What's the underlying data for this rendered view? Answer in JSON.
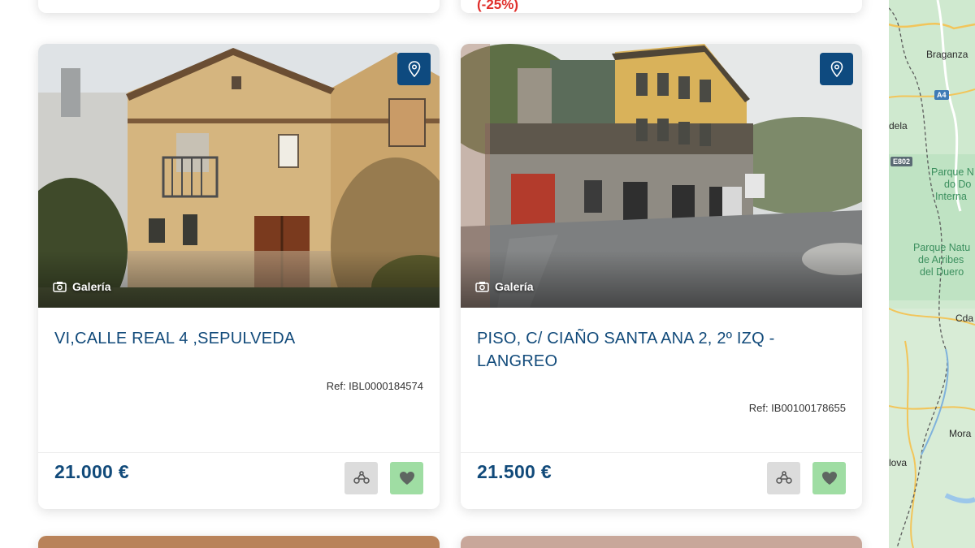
{
  "listings": [
    {
      "title": "VI,CALLE REAL 4 ,SEPULVEDA",
      "ref": "Ref: IBL0000184574",
      "price": "21.000 €",
      "gallery_label": "Galería",
      "pin_icon": "map-pin-icon",
      "compare_icon": "compare-icon",
      "favorite_icon": "heart-icon"
    },
    {
      "title": "PISO, C/ CIAÑO SANTA ANA 2, 2º IZQ - LANGREO",
      "ref": "Ref: IB00100178655",
      "price": "21.500 €",
      "gallery_label": "Galería",
      "pin_icon": "map-pin-icon",
      "compare_icon": "compare-icon",
      "favorite_icon": "heart-icon"
    }
  ],
  "previous_row": {
    "discount_text": "(-25%)"
  },
  "map": {
    "labels": [
      "Braganza",
      "dela",
      "Parque N",
      "do Do",
      "Interna",
      "Parque Natu",
      "de Arribes",
      "del Duero",
      "Cda",
      "Mora",
      "lova"
    ],
    "road_badges": [
      "A4",
      "E802"
    ]
  },
  "colors": {
    "title_blue": "#114a7a",
    "pin_button": "#0e4a7f",
    "favorite_button": "#9fdda3",
    "compare_button": "#dcdcdc",
    "discount_red": "#e0302c"
  }
}
